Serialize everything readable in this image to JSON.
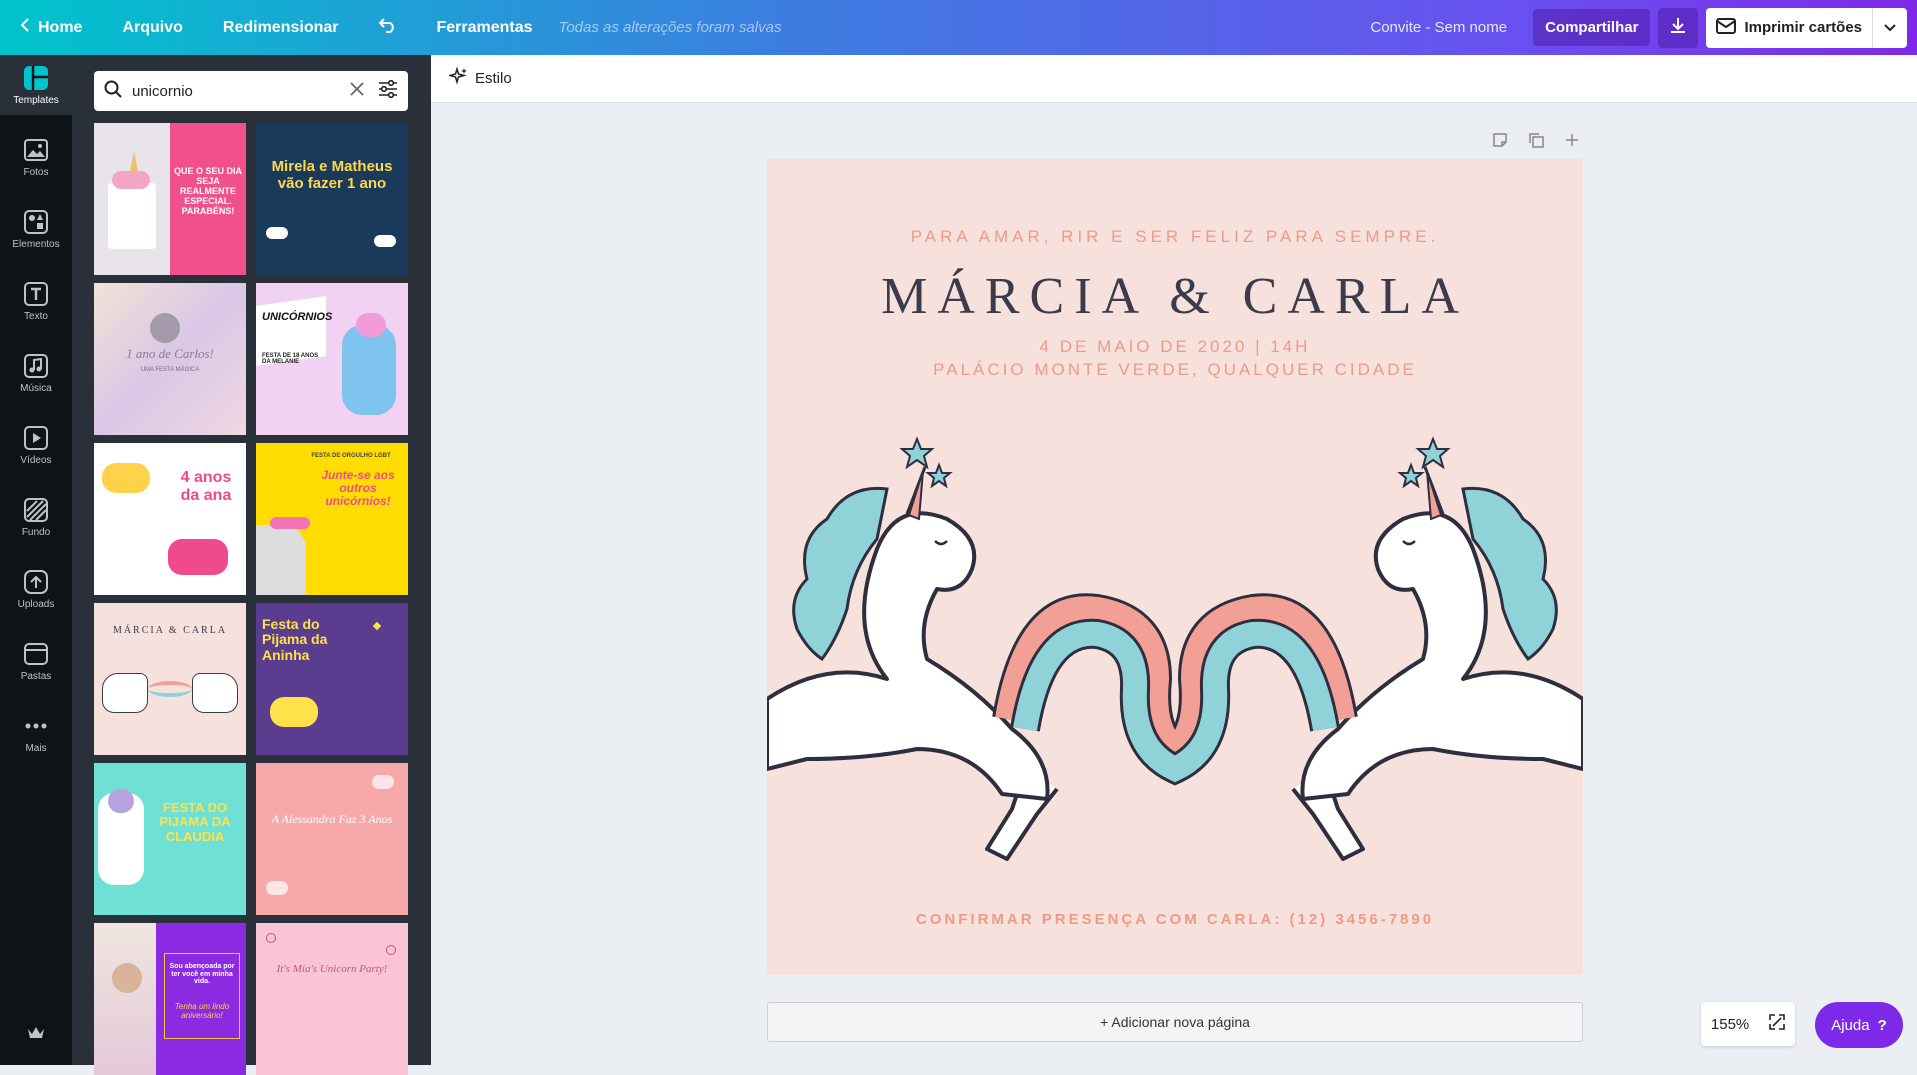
{
  "topbar": {
    "home": "Home",
    "file": "Arquivo",
    "resize": "Redimensionar",
    "tools": "Ferramentas",
    "saved_status": "Todas as alterações foram salvas",
    "doc_name": "Convite - Sem nome",
    "share": "Compartilhar",
    "print": "Imprimir cartões"
  },
  "rail": {
    "items": [
      {
        "label": "Templates",
        "icon": "templates-icon"
      },
      {
        "label": "Fotos",
        "icon": "photos-icon"
      },
      {
        "label": "Elementos",
        "icon": "elements-icon"
      },
      {
        "label": "Texto",
        "icon": "text-icon"
      },
      {
        "label": "Música",
        "icon": "music-icon"
      },
      {
        "label": "Vídeos",
        "icon": "video-icon"
      },
      {
        "label": "Fundo",
        "icon": "background-icon"
      },
      {
        "label": "Uploads",
        "icon": "upload-icon"
      },
      {
        "label": "Pastas",
        "icon": "folder-icon"
      },
      {
        "label": "Mais",
        "icon": "more-icon"
      }
    ]
  },
  "search": {
    "value": "unicornio"
  },
  "templates": [
    {
      "title": "QUE O SEU DIA SEJA REALMENTE ESPECIAL. PARABÉNS!",
      "bg": "#f0508c"
    },
    {
      "title": "Mirela e Matheus vão fazer 1 ano",
      "bg": "#1a3a5c"
    },
    {
      "title": "1 ano de Carlos!",
      "sub": "UMA FESTA MÁGICA",
      "bg": "#e8d8e6"
    },
    {
      "title": "UNICÓRNIOS",
      "sub": "FESTA DE 18 ANOS DA MELANIE",
      "bg": "#f1d2f2"
    },
    {
      "title": "4 anos da ana",
      "bg": "#ffffff"
    },
    {
      "title": "Junte-se aos outros unicórnios!",
      "sub": "FESTA DE ORGULHO LGBT",
      "bg": "#ffdd00"
    },
    {
      "title": "MÁRCIA & CARLA",
      "bg": "#f6e1dd"
    },
    {
      "title": "Festa do Pijama da Aninha",
      "bg": "#5a3d8f"
    },
    {
      "title": "FESTA DO PIJAMA DA CLAUDIA",
      "bg": "#6fe0d6"
    },
    {
      "title": "A Alessandra Faz 3 Anos",
      "bg": "#f7a9a9"
    },
    {
      "title": "Sou abençoada por ter você em minha vida.",
      "sub": "Tenha um lindo aniversário!",
      "bg": "#8a2be2"
    },
    {
      "title": "It's Mia's Unicorn Party!",
      "bg": "#fbc4d6"
    }
  ],
  "editor": {
    "style_button": "Estilo",
    "add_page": "+ Adicionar nova página",
    "zoom": "155%",
    "help": "Ajuda",
    "help_mark": "?"
  },
  "design": {
    "tagline": "PARA AMAR, RIR E SER FELIZ PARA SEMPRE.",
    "names": "MÁRCIA & CARLA",
    "date": "4 DE MAIO DE 2020 | 14H",
    "place": "PALÁCIO MONTE VERDE, QUALQUER CIDADE",
    "rsvp": "CONFIRMAR PRESENÇA COM CARLA: (12) 3456-7890"
  },
  "colors": {
    "accent": "#7d2ae8",
    "page_bg": "#f6e1dd",
    "coral_text": "#ef9a86",
    "title_text": "#3b3b4a"
  }
}
